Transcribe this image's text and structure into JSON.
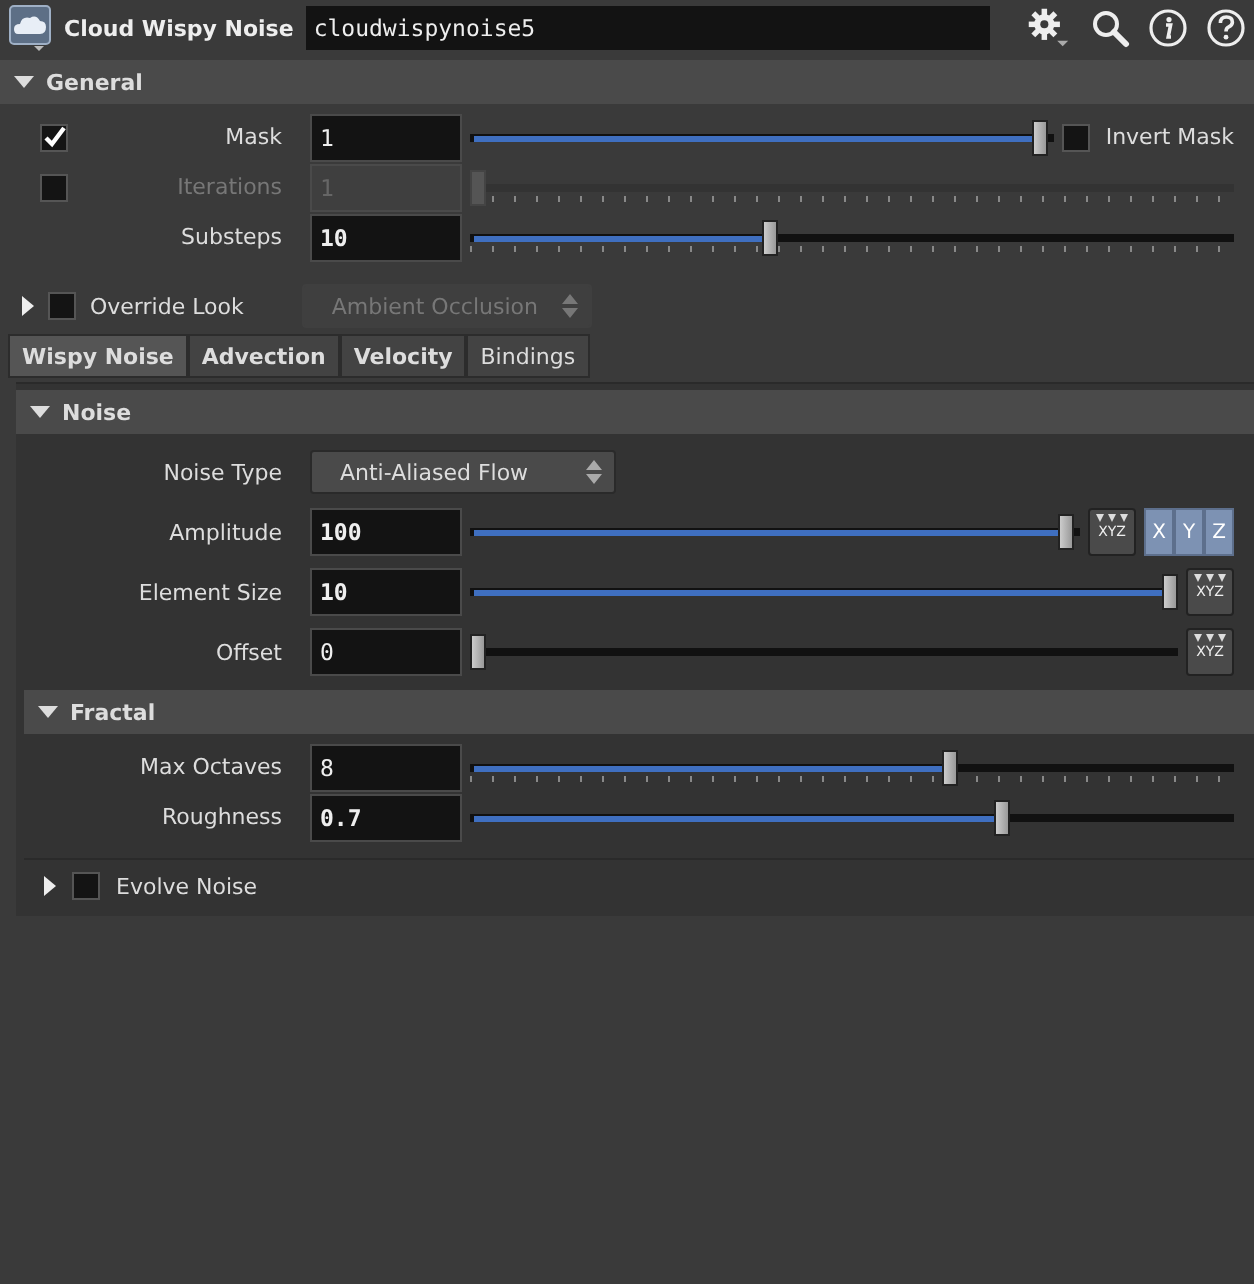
{
  "node": {
    "type_label": "Cloud Wispy Noise",
    "name": "cloudwispynoise5"
  },
  "general": {
    "title": "General",
    "expanded": true,
    "params": [
      {
        "kind": "slider",
        "label": "Mask",
        "toggle": {
          "checked": true
        },
        "value": "1",
        "modified": false,
        "disabled": false,
        "level": 0.99,
        "ticks": false,
        "extra_toggle": {
          "label": "Invert Mask",
          "checked": false
        }
      },
      {
        "kind": "slider",
        "label": "Iterations",
        "toggle": {
          "checked": false
        },
        "value": "1",
        "modified": false,
        "disabled": true,
        "level": 0,
        "ticks": true
      },
      {
        "kind": "slider",
        "label": "Substeps",
        "value": "10",
        "modified": true,
        "disabled": false,
        "level": 0.39,
        "ticks": true
      }
    ]
  },
  "override_look": {
    "label": "Override Look",
    "expanded": false,
    "checked": false,
    "menu": {
      "value": "Ambient Occlusion",
      "disabled": true
    }
  },
  "tabs": [
    {
      "label": "Wispy Noise",
      "selected": true
    },
    {
      "label": "Advection",
      "selected": false
    },
    {
      "label": "Velocity",
      "selected": false
    },
    {
      "label": "Bindings",
      "selected": false
    }
  ],
  "noise": {
    "title": "Noise",
    "expanded": true,
    "params": [
      {
        "kind": "menu",
        "label": "Noise Type",
        "value": "Anti-Aliased Flow",
        "disabled": false
      },
      {
        "kind": "slider",
        "label": "Amplitude",
        "value": "100",
        "modified": true,
        "disabled": false,
        "level": 0.99,
        "ticks": false,
        "vector_label": "XYZ",
        "axes": [
          "X",
          "Y",
          "Z"
        ]
      },
      {
        "kind": "slider",
        "label": "Element Size",
        "value": "10",
        "modified": true,
        "disabled": false,
        "level": 1,
        "ticks": false,
        "vector_label": "XYZ"
      },
      {
        "kind": "slider",
        "label": "Offset",
        "value": "0",
        "modified": false,
        "disabled": false,
        "level": 0,
        "ticks": false,
        "vector_label": "XYZ"
      }
    ]
  },
  "fractal": {
    "title": "Fractal",
    "expanded": true,
    "params": [
      {
        "kind": "slider",
        "label": "Max Octaves",
        "value": "8",
        "modified": false,
        "disabled": false,
        "level": 0.63,
        "ticks": true
      },
      {
        "kind": "slider",
        "label": "Roughness",
        "value": "0.7",
        "modified": true,
        "disabled": false,
        "level": 0.7,
        "ticks": false
      }
    ]
  },
  "evolve": {
    "label": "Evolve Noise",
    "expanded": false,
    "checked": false
  }
}
